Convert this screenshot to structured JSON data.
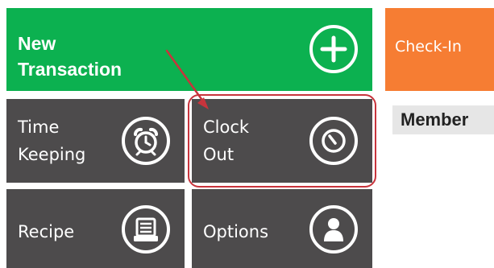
{
  "colors": {
    "tile_green": "#0cb150",
    "tile_dark": "#4d4b4c",
    "tile_orange": "#f67d33",
    "annotation_red": "#c8343c"
  },
  "tiles": {
    "new_transaction": {
      "label": "New\nTransaction",
      "icon": "plus-icon"
    },
    "time_keeping": {
      "label": "Time\nKeeping",
      "icon": "alarm-clock-icon"
    },
    "clock_out": {
      "label": "Clock\nOut",
      "icon": "clock-out-icon"
    },
    "recipe": {
      "label": "Recipe",
      "icon": "receipt-icon"
    },
    "options": {
      "label": "Options",
      "icon": "user-icon"
    },
    "check_in": {
      "label": "Check-In"
    }
  },
  "member_label": "Member"
}
